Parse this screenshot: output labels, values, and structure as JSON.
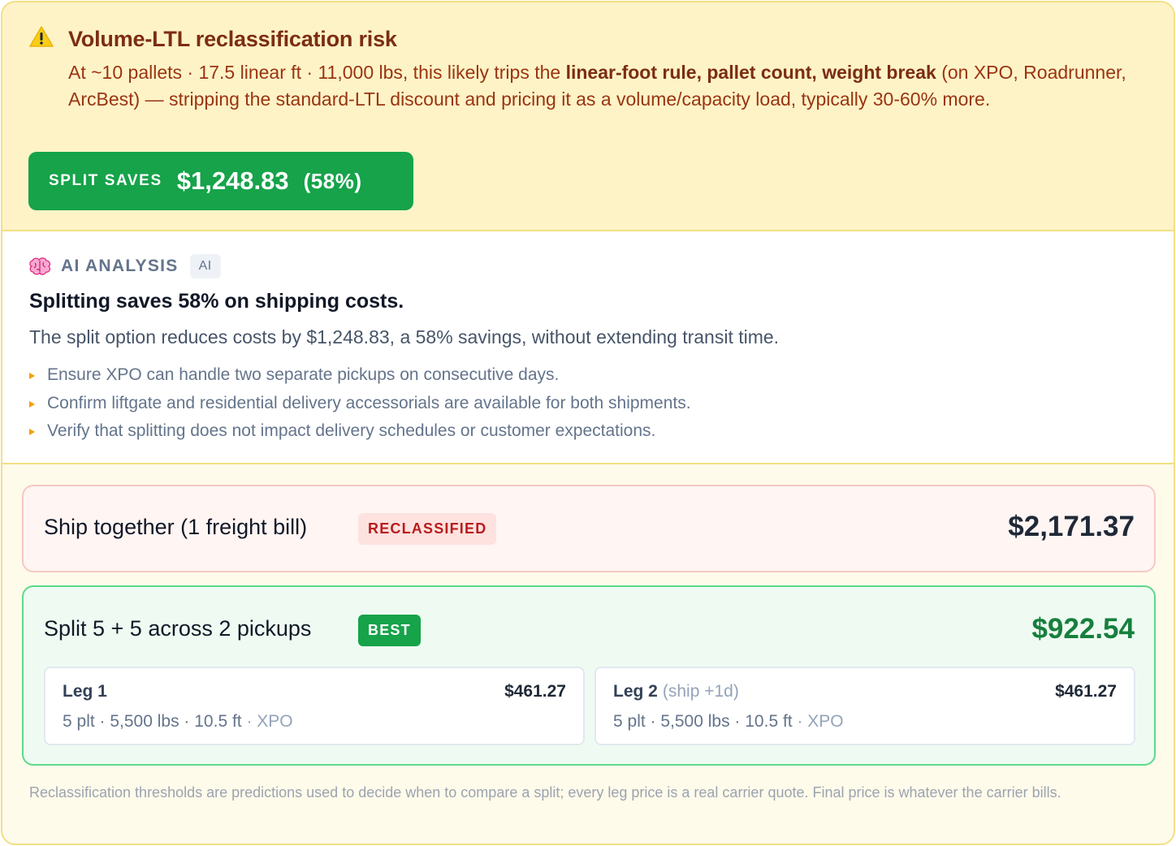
{
  "warning": {
    "icon": "warning-triangle-icon",
    "title": "Volume-LTL reclassification risk",
    "body_start": "At ~10 pallets · 17.5 linear ft · 11,000 lbs, this likely trips the ",
    "body_bold": "linear-foot rule, pallet count, weight break",
    "body_end": " (on XPO, Roadrunner, ArcBest) — stripping the standard-LTL discount and pricing it as a volume/capacity load, typically 30-60% more."
  },
  "savings": {
    "label": "SPLIT SAVES",
    "amount": "$1,248.83",
    "percent": "(58%)",
    "color": "#16a34a"
  },
  "ai_analysis": {
    "icon": "brain-icon",
    "label": "AI ANALYSIS",
    "badge": "AI",
    "headline": "Splitting saves 58% on shipping costs.",
    "summary": "The split option reduces costs by $1,248.83, a 58% savings, without extending transit time.",
    "bullets": [
      "Ensure XPO can handle two separate pickups on consecutive days.",
      "Confirm liftgate and residential delivery accessorials are available for both shipments.",
      "Verify that splitting does not impact delivery schedules or customer expectations."
    ]
  },
  "options": {
    "together": {
      "title": "Ship together (1 freight bill)",
      "badge": "RECLASSIFIED",
      "price": "$2,171.37"
    },
    "split": {
      "title": "Split 5 + 5 across 2 pickups",
      "badge": "BEST",
      "price": "$922.54",
      "legs": [
        {
          "name": "Leg 1",
          "note": "",
          "price": "$461.27",
          "meta": "5 plt · 5,500 lbs · 10.5 ft",
          "carrier": " · XPO"
        },
        {
          "name": "Leg 2",
          "note": "(ship +1d)",
          "price": "$461.27",
          "meta": "5 plt · 5,500 lbs · 10.5 ft",
          "carrier": " · XPO"
        }
      ]
    }
  },
  "footnote": "Reclassification thresholds are predictions used to decide when to compare a split; every leg price is a real carrier quote. Final price is whatever the carrier bills."
}
